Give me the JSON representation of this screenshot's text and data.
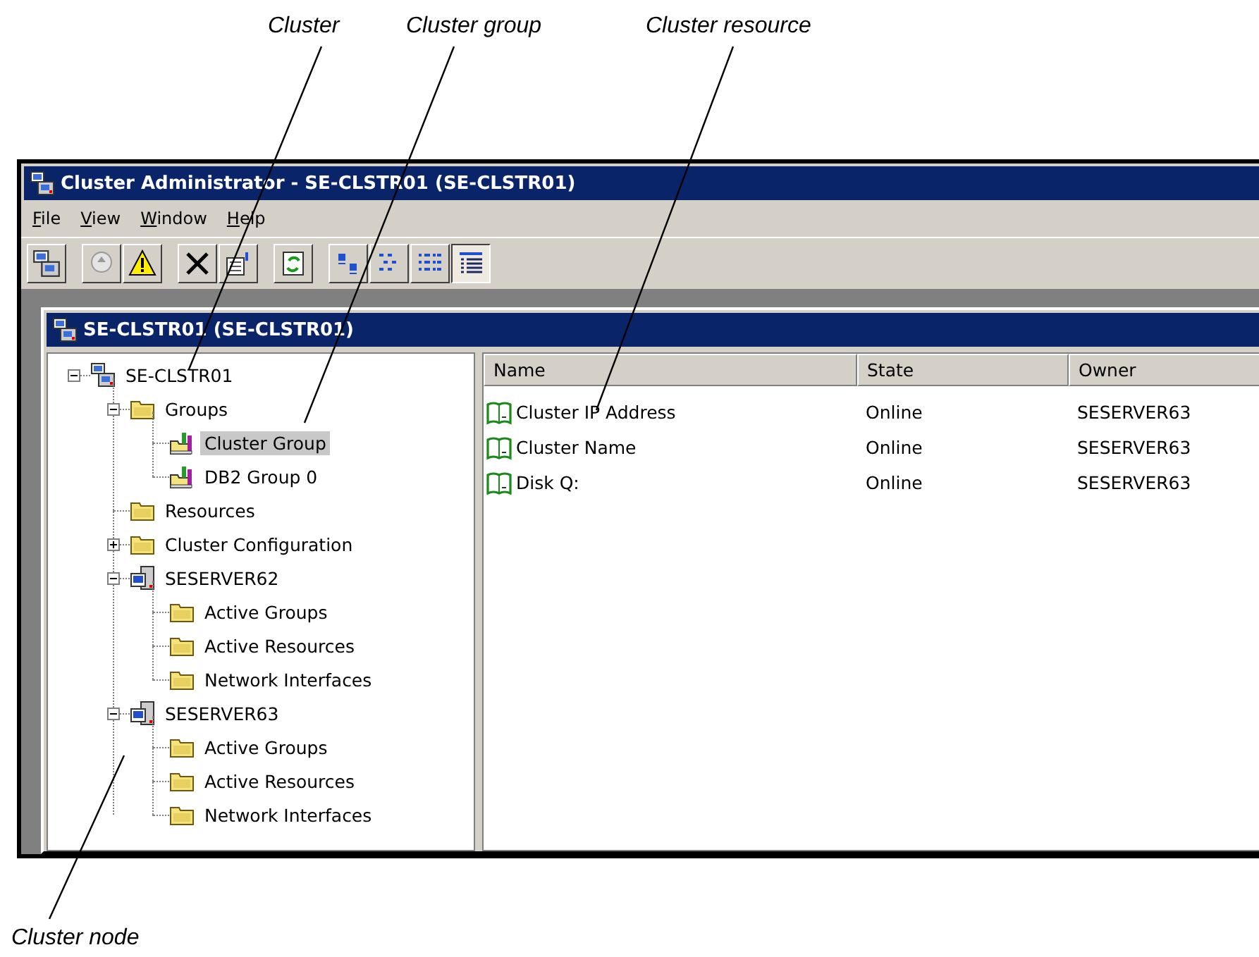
{
  "callouts": [
    {
      "label": "Cluster"
    },
    {
      "label": "Cluster group"
    },
    {
      "label": "Cluster resource"
    },
    {
      "label": "Cluster node"
    }
  ],
  "window": {
    "title": "Cluster Administrator - SE-CLSTR01 (SE-CLSTR01)"
  },
  "menu": [
    {
      "label": "File"
    },
    {
      "label": "View"
    },
    {
      "label": "Window"
    },
    {
      "label": "Help"
    }
  ],
  "toolbar": [
    {
      "selected": false
    },
    {
      "selected": false
    },
    {
      "selected": false
    },
    {
      "selected": false
    },
    {
      "selected": false
    },
    {
      "selected": false
    },
    {
      "selected": false
    },
    {
      "selected": false
    },
    {
      "selected": false
    },
    {
      "selected": true
    }
  ],
  "child_window": {
    "title": "SE-CLSTR01 (SE-CLSTR01)"
  },
  "tree": [
    {
      "label": "SE-CLSTR01",
      "kind": "cluster",
      "expanded": true,
      "selected": false,
      "children": [
        {
          "label": "Groups",
          "kind": "folder",
          "expanded": true,
          "selected": false,
          "children": [
            {
              "label": "Cluster Group",
              "kind": "group",
              "selected": true
            },
            {
              "label": "DB2 Group 0",
              "kind": "group",
              "selected": false
            }
          ]
        },
        {
          "label": "Resources",
          "kind": "folder",
          "selected": false
        },
        {
          "label": "Cluster Configuration",
          "kind": "folder",
          "expanded": false,
          "selected": false
        },
        {
          "label": "SESERVER62",
          "kind": "server",
          "expanded": true,
          "selected": false,
          "children": [
            {
              "label": "Active Groups",
              "kind": "folder",
              "selected": false
            },
            {
              "label": "Active Resources",
              "kind": "folder",
              "selected": false
            },
            {
              "label": "Network Interfaces",
              "kind": "folder",
              "selected": false
            }
          ]
        },
        {
          "label": "SESERVER63",
          "kind": "server",
          "expanded": true,
          "selected": false,
          "children": [
            {
              "label": "Active Groups",
              "kind": "folder",
              "selected": false
            },
            {
              "label": "Active Resources",
              "kind": "folder",
              "selected": false
            },
            {
              "label": "Network Interfaces",
              "kind": "folder",
              "selected": false
            }
          ]
        }
      ]
    }
  ],
  "table": {
    "columns": [
      "Name",
      "State",
      "Owner"
    ],
    "rows": [
      [
        "Cluster IP Address",
        "Online",
        "SESERVER63"
      ],
      [
        "Cluster Name",
        "Online",
        "SESERVER63"
      ],
      [
        "Disk Q:",
        "Online",
        "SESERVER63"
      ]
    ]
  }
}
